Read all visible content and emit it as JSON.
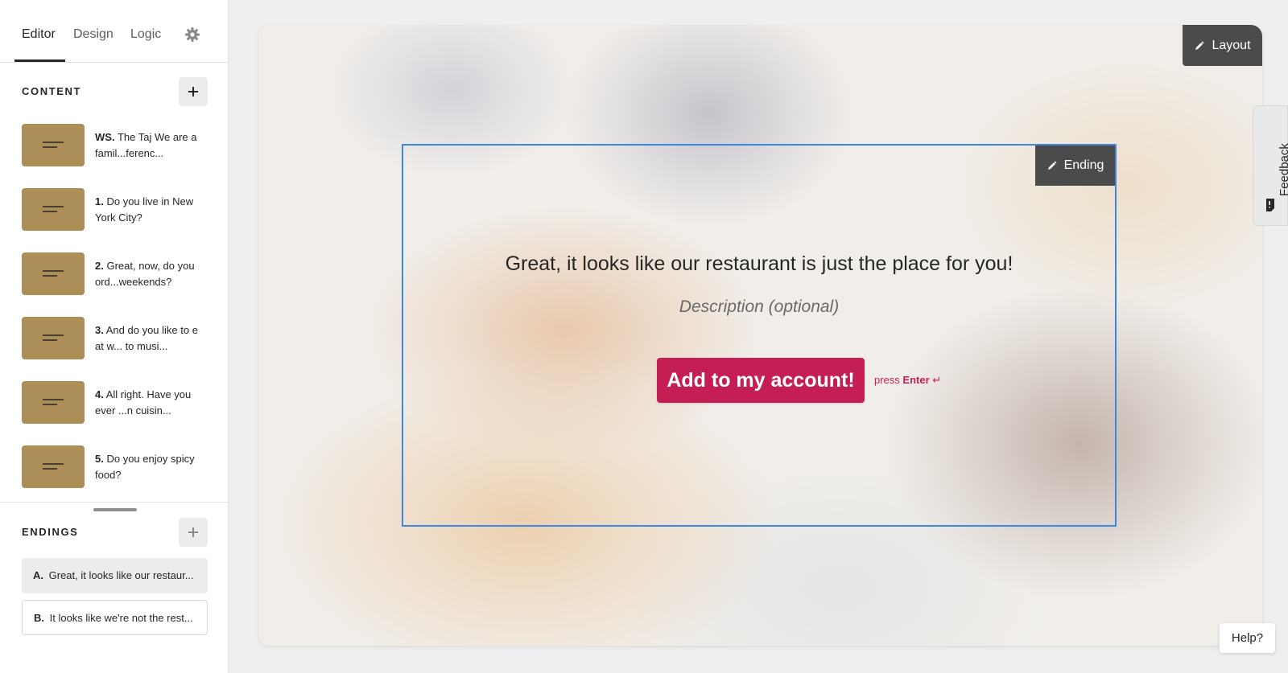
{
  "sidebar": {
    "tabs": [
      {
        "label": "Editor"
      },
      {
        "label": "Design"
      },
      {
        "label": "Logic"
      }
    ],
    "content_title": "CONTENT",
    "endings_title": "ENDINGS",
    "questions": [
      {
        "num": "WS.",
        "text": "The Taj We are a famil...ferenc..."
      },
      {
        "num": "1.",
        "text": "Do you live in New York City?"
      },
      {
        "num": "2.",
        "text": "Great, now, do you ord...weekends?"
      },
      {
        "num": "3.",
        "text": "And do you like to eat w... to musi..."
      },
      {
        "num": "4.",
        "text": "All right. Have you ever ...n cuisin..."
      },
      {
        "num": "5.",
        "text": "Do you enjoy spicy food?"
      }
    ],
    "endings": [
      {
        "num": "A.",
        "text": "Great, it looks like our restaur..."
      },
      {
        "num": "B.",
        "text": "It looks like we're not the rest..."
      }
    ]
  },
  "canvas": {
    "layout_label": "Layout",
    "ending_label": "Ending",
    "title": "Great, it looks like our restaurant is just the place for you!",
    "description_placeholder": "Description (optional)",
    "button_label": "Add to my account!",
    "press_text": "press",
    "enter_text": "Enter",
    "enter_symbol": "↵"
  },
  "feedback_label": "Feedback",
  "help_label": "Help?",
  "colors": {
    "accent": "#c51e54",
    "thumb": "#ac8e58",
    "selection": "#3d87e0",
    "tag_bg": "#4b4b4b"
  }
}
